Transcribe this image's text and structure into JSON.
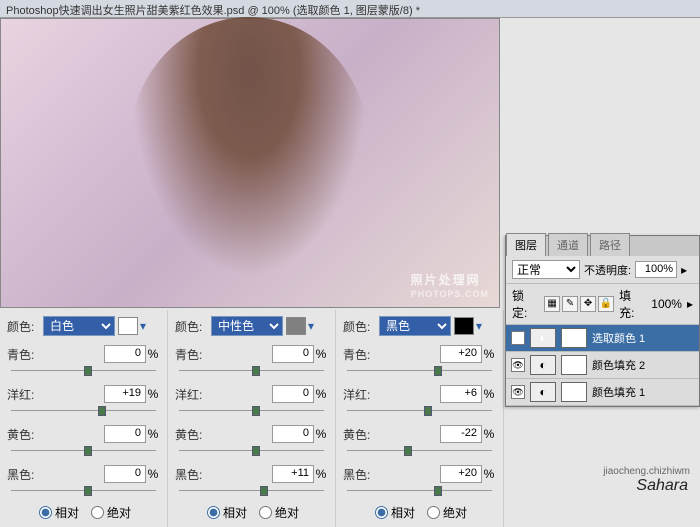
{
  "title_bar": "Photoshop快速调出女生照片甜美紫红色效果.psd @ 100% (选取颜色 1, 图层蒙版/8) *",
  "watermark": {
    "main": "照片处理网",
    "sub": "PHOTOPS.COM"
  },
  "panels": [
    {
      "color_label": "颜色:",
      "color_value": "白色",
      "swatch": "#ffffff",
      "rows": [
        {
          "label": "青色:",
          "value": "0",
          "thumb": 50
        },
        {
          "label": "洋红:",
          "value": "+19",
          "thumb": 60
        },
        {
          "label": "黄色:",
          "value": "0",
          "thumb": 50
        },
        {
          "label": "黑色:",
          "value": "0",
          "thumb": 50
        }
      ]
    },
    {
      "color_label": "颜色:",
      "color_value": "中性色",
      "swatch": "#808080",
      "rows": [
        {
          "label": "青色:",
          "value": "0",
          "thumb": 50
        },
        {
          "label": "洋红:",
          "value": "0",
          "thumb": 50
        },
        {
          "label": "黄色:",
          "value": "0",
          "thumb": 50
        },
        {
          "label": "黑色:",
          "value": "+11",
          "thumb": 56
        }
      ]
    },
    {
      "color_label": "颜色:",
      "color_value": "黑色",
      "swatch": "#000000",
      "rows": [
        {
          "label": "青色:",
          "value": "+20",
          "thumb": 60
        },
        {
          "label": "洋红:",
          "value": "+6",
          "thumb": 53
        },
        {
          "label": "黄色:",
          "value": "-22",
          "thumb": 39
        },
        {
          "label": "黑色:",
          "value": "+20",
          "thumb": 60
        }
      ]
    }
  ],
  "radio": {
    "relative": "相对",
    "absolute": "绝对"
  },
  "pct": "%",
  "layers": {
    "tabs": [
      "图层",
      "通道",
      "路径"
    ],
    "blend": "正常",
    "opacity_label": "不透明度:",
    "opacity_value": "100%",
    "lock_label": "锁定:",
    "fill_label": "填充:",
    "fill_value": "100%",
    "items": [
      {
        "name": "选取颜色 1",
        "selected": true,
        "adj": true
      },
      {
        "name": "颜色填充 2",
        "selected": false,
        "adj": true
      },
      {
        "name": "颜色填充 1",
        "selected": false,
        "adj": true
      }
    ]
  },
  "url": "jiaocheng.chizhiwm",
  "signature": "Sahara"
}
